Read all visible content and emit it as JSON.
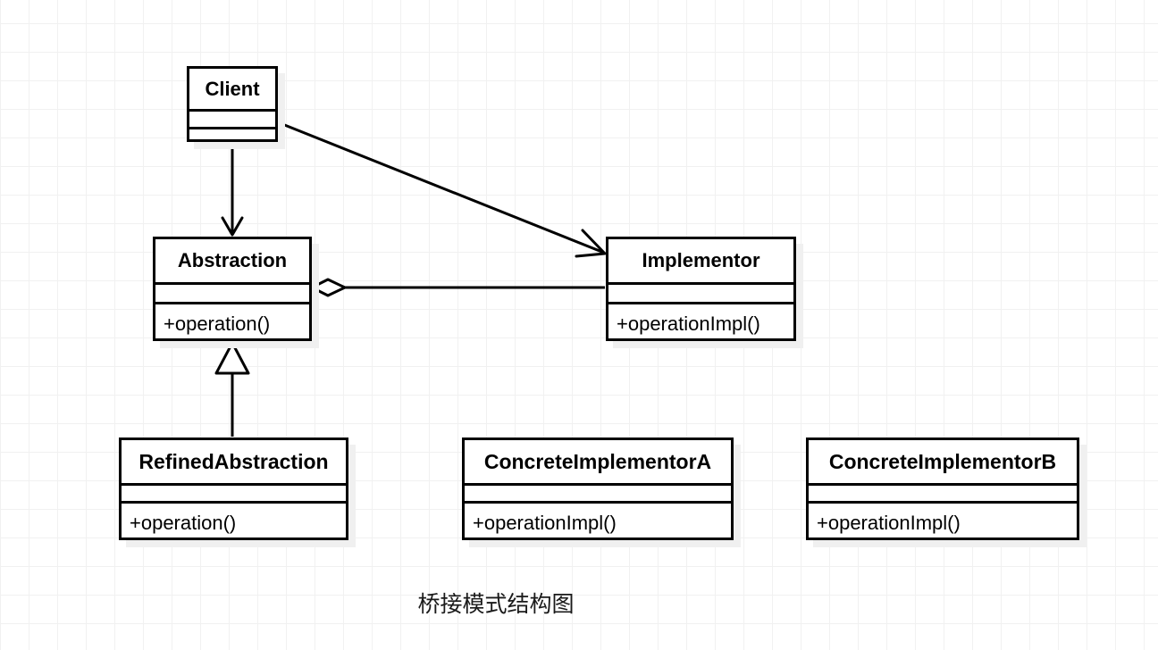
{
  "diagram": {
    "title_caption": "桥接模式结构图",
    "pattern": "Bridge",
    "background_color": "#ffffff",
    "grid_color": "#f1f1f1",
    "line_color": "#000000",
    "shadow_color": "#f0f0f0",
    "classes": [
      {
        "id": "client",
        "name": "Client",
        "attributes": [],
        "operations": []
      },
      {
        "id": "abstraction",
        "name": "Abstraction",
        "attributes": [],
        "operations": [
          "+operation()"
        ]
      },
      {
        "id": "implementor",
        "name": "Implementor",
        "attributes": [],
        "operations": [
          "+operationImpl()"
        ]
      },
      {
        "id": "refined-abstraction",
        "name": "RefinedAbstraction",
        "attributes": [],
        "operations": [
          "+operation()"
        ]
      },
      {
        "id": "concrete-implementor-a",
        "name": "ConcreteImplementorA",
        "attributes": [],
        "operations": [
          "+operationImpl()"
        ]
      },
      {
        "id": "concrete-implementor-b",
        "name": "ConcreteImplementorB",
        "attributes": [],
        "operations": [
          "+operationImpl()"
        ]
      }
    ],
    "relations": [
      {
        "id": "client-to-abstraction",
        "from": "Client",
        "to": "Abstraction",
        "type": "association-arrow"
      },
      {
        "id": "client-to-implementor",
        "from": "Client",
        "to": "Implementor",
        "type": "association-arrow"
      },
      {
        "id": "abstraction-to-implementor",
        "from": "Abstraction",
        "to": "Implementor",
        "type": "aggregation"
      },
      {
        "id": "refined-to-abstraction",
        "from": "RefinedAbstraction",
        "to": "Abstraction",
        "type": "generalization"
      }
    ]
  }
}
